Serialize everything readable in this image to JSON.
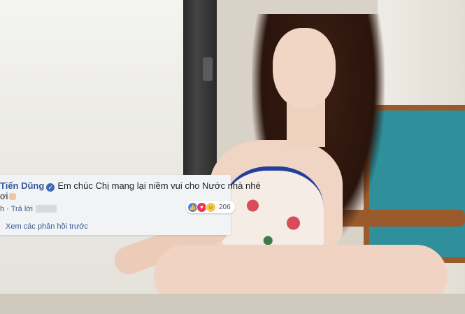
{
  "comment": {
    "author": "Tiến Dũng",
    "text_line1": "Em chúc Chị mang lại niềm vui cho Nước nhà nhé",
    "text_line2": "ơi",
    "time_fragment": "h",
    "reply_label": "Trả lời",
    "reaction_count": "206",
    "reactions": [
      "like-icon",
      "love-icon",
      "haha-icon"
    ],
    "view_previous_replies": "Xem các phản hồi trước"
  },
  "colors": {
    "link_blue": "#365899",
    "verified_blue": "#4267b2",
    "comment_bg": "#f2f3f5"
  }
}
